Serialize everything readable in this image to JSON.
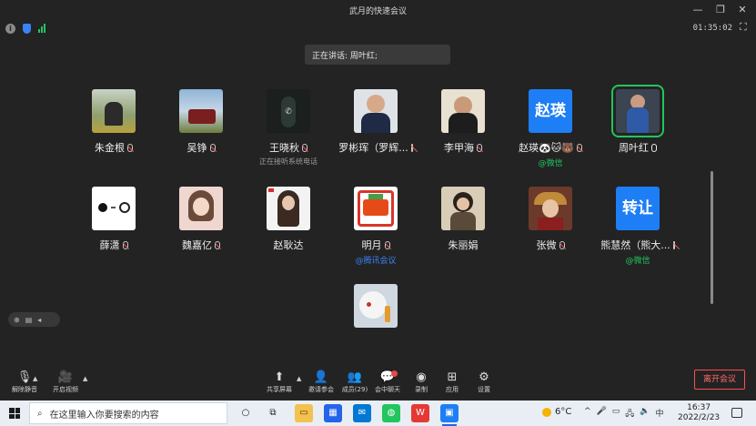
{
  "window": {
    "title": "武月的快速会议",
    "minimize": "—",
    "maximize": "❐",
    "close": "✕"
  },
  "status": {
    "timer": "01:35:02"
  },
  "speaking": {
    "text": "正在讲话: 周叶红;"
  },
  "participants": [
    {
      "name": "朱金根",
      "mic": "muted",
      "sub": ""
    },
    {
      "name": "吴铮",
      "mic": "muted",
      "sub": ""
    },
    {
      "name": "王晓秋",
      "mic": "muted",
      "sub": "正在接听系统电话"
    },
    {
      "name": "罗彬珲（罗辉...",
      "mic": "muted",
      "sub": ""
    },
    {
      "name": "李甲海",
      "mic": "muted",
      "sub": ""
    },
    {
      "name": "赵瑛🐼🐱🐻",
      "avatar_text": "赵瑛",
      "mic": "muted",
      "sub": "@微信"
    },
    {
      "name": "周叶红",
      "mic": "on",
      "sub": ""
    },
    {
      "name": "薛潇",
      "mic": "muted",
      "sub": ""
    },
    {
      "name": "魏嘉亿",
      "mic": "muted",
      "sub": ""
    },
    {
      "name": "赵耿达",
      "mic": "none",
      "sub": ""
    },
    {
      "name": "明月",
      "mic": "muted",
      "sub": "@腾讯会议"
    },
    {
      "name": "朱丽娟",
      "mic": "none",
      "sub": ""
    },
    {
      "name": "张微",
      "mic": "muted",
      "sub": ""
    },
    {
      "name": "熊慧然（熊大...",
      "avatar_text": "转让",
      "mic": "muted",
      "sub": "@微信"
    },
    {
      "name": "",
      "mic": "none",
      "sub": ""
    }
  ],
  "toolbar": {
    "unmute": "解除静音",
    "video": "开启视频",
    "share": "共享屏幕",
    "invite": "邀请参会",
    "members": "成员(29)",
    "chat": "会中聊天",
    "record": "录制",
    "apps": "应用",
    "settings": "设置",
    "leave": "离开会议"
  },
  "taskbar": {
    "search_placeholder": "在这里输入你要搜索的内容",
    "weather": "6°C",
    "ime": "中",
    "time": "16:37",
    "date": "2022/2/23"
  },
  "colors": {
    "accent_green": "#22c55e",
    "accent_blue": "#1e7ef5",
    "danger": "#ff4d4f"
  }
}
